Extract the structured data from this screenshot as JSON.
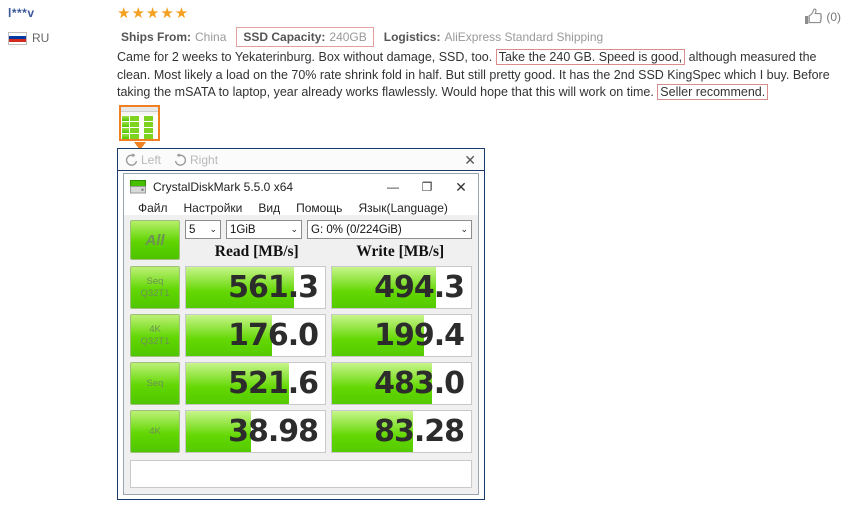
{
  "review": {
    "reviewer_name": "l***v",
    "country_code": "RU",
    "stars": "★★★★★",
    "like_count": "(0)",
    "attributes": [
      {
        "key": "Ships From:",
        "value": "China",
        "boxed": false
      },
      {
        "key": "SSD Capacity:",
        "value": "240GB",
        "boxed": true
      },
      {
        "key": "Logistics:",
        "value": "AliExpress Standard Shipping",
        "boxed": false
      }
    ],
    "text_part_1": "Came for 2 weeks to Yekaterinburg. Box without damage, SSD, too. ",
    "highlight_1": "Take the 240 GB. Speed is good,",
    "text_part_2": " although measured the clean. Most likely a load on the 70% rate shrink fold in half. But still pretty good. It has the 2nd SSD KingSpec which I buy. Before taking the mSATA to laptop, year already works flawlessly. Would hope that this will work on time. ",
    "highlight_2": "Seller recommend."
  },
  "viewer": {
    "rotate_left_label": "Left",
    "rotate_right_label": "Right",
    "close_label": "✕"
  },
  "cdm": {
    "title": "CrystalDiskMark 5.5.0 x64",
    "menu": [
      "Файл",
      "Настройки",
      "Вид",
      "Помощь",
      "Язык(Language)"
    ],
    "window_buttons": {
      "minimize": "—",
      "maximize": "❐",
      "close": "✕"
    },
    "all_button": "All",
    "selects": {
      "run_count": "5",
      "test_size": "1GiB",
      "drive": "G: 0% (0/224GiB)",
      "chevron": "⌄"
    },
    "columns": [
      "Read [MB/s]",
      "Write [MB/s]"
    ],
    "rows": [
      {
        "label_top": "Seq",
        "label_bottom": "Q32T1",
        "read": "561.3",
        "write": "494.3",
        "read_fill": 78,
        "write_fill": 75
      },
      {
        "label_top": "4K",
        "label_bottom": "Q32T1",
        "read": "176.0",
        "write": "199.4",
        "read_fill": 62,
        "write_fill": 66
      },
      {
        "label_top": "Seq",
        "label_bottom": "",
        "read": "521.6",
        "write": "483.0",
        "read_fill": 74,
        "write_fill": 72
      },
      {
        "label_top": "4K",
        "label_bottom": "",
        "read": "38.98",
        "write": "83.28",
        "read_fill": 47,
        "write_fill": 58
      }
    ],
    "status_text": ""
  },
  "colors": {
    "star": "#f4a020",
    "green_bar": "#5fd400",
    "highlight_border": "#d98c8c",
    "frame": "#1b3a6b",
    "link": "#3b5998",
    "thumb_border": "#f08020"
  }
}
